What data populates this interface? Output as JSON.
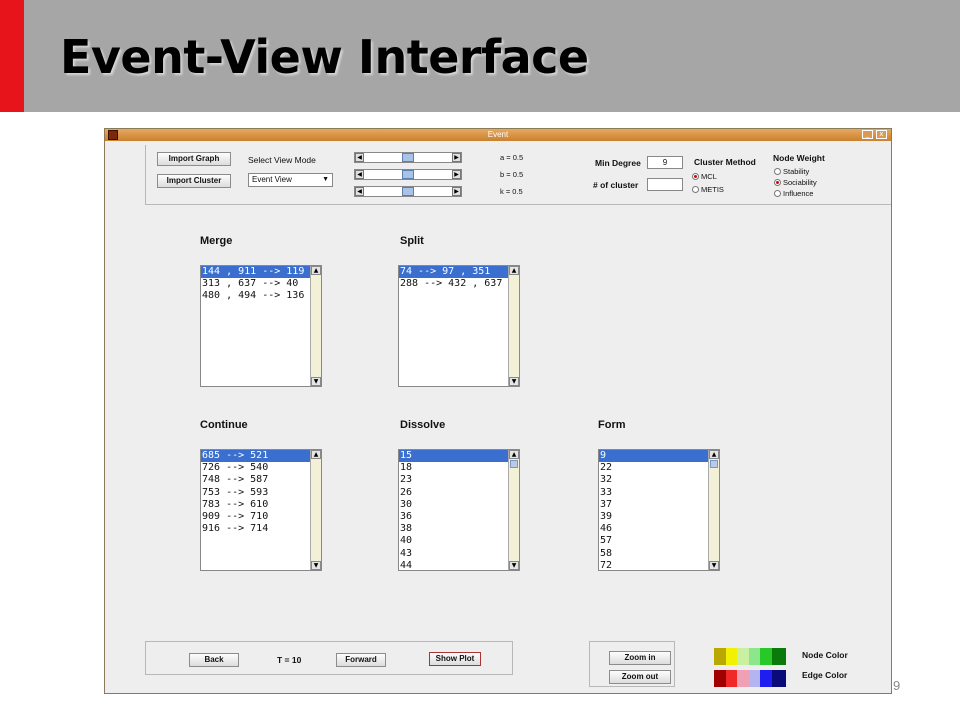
{
  "slide": {
    "title": "Event-View  Interface",
    "page_number": "9"
  },
  "window": {
    "title": "Event",
    "controls": {
      "minimize": "_",
      "close": "x"
    }
  },
  "toolbar": {
    "import_graph_label": "Import Graph",
    "import_cluster_label": "Import Cluster",
    "select_view_mode_label": "Select View Mode",
    "view_mode_value": "Event View",
    "sliders": [
      {
        "label": "a = 0.5",
        "value": 0.5
      },
      {
        "label": "b = 0.5",
        "value": 0.5
      },
      {
        "label": "k = 0.5",
        "value": 0.5
      }
    ],
    "min_degree_label": "Min Degree",
    "min_degree_value": "9",
    "num_cluster_label": "# of cluster",
    "num_cluster_value": "",
    "cluster_method_label": "Cluster Method",
    "cluster_methods": [
      {
        "label": "MCL",
        "selected": true
      },
      {
        "label": "METIS",
        "selected": false
      }
    ],
    "node_weight_label": "Node Weight",
    "node_weights": [
      {
        "label": "Stability",
        "selected": false
      },
      {
        "label": "Sociability",
        "selected": true
      },
      {
        "label": "Influence",
        "selected": false
      }
    ]
  },
  "events": {
    "merge": {
      "title": "Merge",
      "items": [
        "144 , 911 --> 119",
        "313 , 637 --> 40",
        "480 , 494 --> 136"
      ],
      "selected_index": 0
    },
    "split": {
      "title": "Split",
      "items": [
        "74 --> 97 , 351",
        "288 --> 432 , 637"
      ],
      "selected_index": 0
    },
    "continue": {
      "title": "Continue",
      "items": [
        "685 --> 521",
        "726 --> 540",
        "748 --> 587",
        "753 --> 593",
        "783 --> 610",
        "909 --> 710",
        "916 --> 714"
      ],
      "selected_index": 0
    },
    "dissolve": {
      "title": "Dissolve",
      "items": [
        "15",
        "18",
        "23",
        "26",
        "30",
        "36",
        "38",
        "40",
        "43",
        "44"
      ],
      "selected_index": 0
    },
    "form": {
      "title": "Form",
      "items": [
        "9",
        "22",
        "32",
        "33",
        "37",
        "39",
        "46",
        "57",
        "58",
        "72"
      ],
      "selected_index": 0
    }
  },
  "bottom": {
    "back_label": "Back",
    "time_label": "T = 10",
    "forward_label": "Forward",
    "show_plot_label": "Show Plot",
    "zoom_in_label": "Zoom in",
    "zoom_out_label": "Zoom out",
    "node_color_label": "Node Color",
    "edge_color_label": "Edge Color",
    "node_colors": [
      "#b8a800",
      "#f2f200",
      "#c8f0a0",
      "#8ce68c",
      "#28c828",
      "#0a7a0a"
    ],
    "edge_colors": [
      "#a00000",
      "#f02828",
      "#f0a0b4",
      "#b4b4f0",
      "#1e1ef0",
      "#0a0a78"
    ]
  }
}
